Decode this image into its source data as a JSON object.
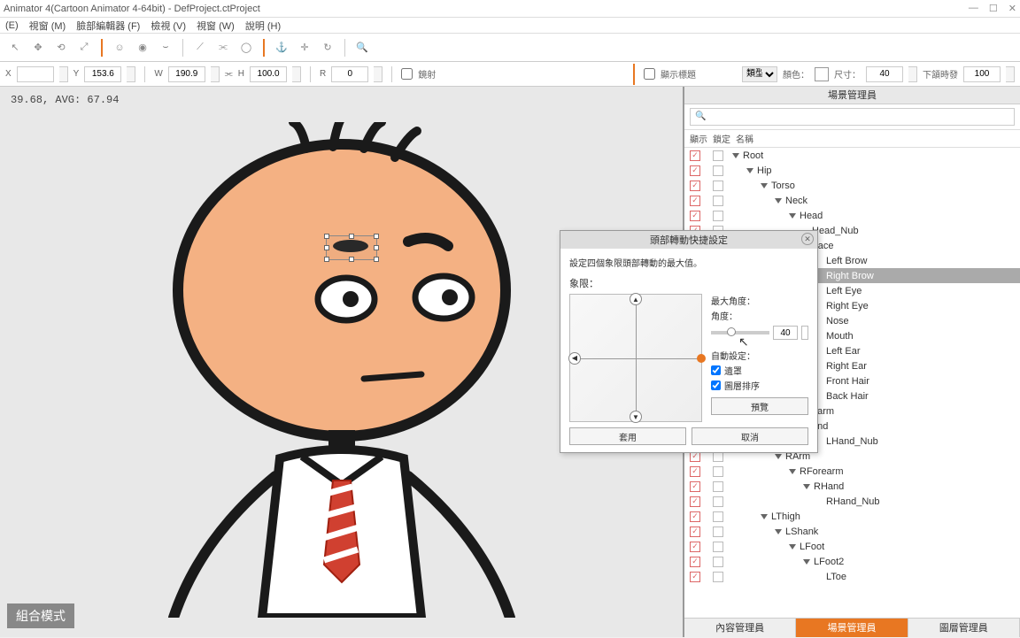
{
  "window": {
    "title": "Animator 4(Cartoon Animator 4-64bit) - DefProject.ctProject"
  },
  "menu": {
    "items": [
      "(E)",
      "視窗 (M)",
      "臉部編輯器 (F)",
      "檢視 (V)",
      "視窗 (W)",
      "說明 (H)"
    ]
  },
  "propbar": {
    "x": "",
    "y": "153.6",
    "w": "190.9",
    "h": "100.0",
    "r": "0",
    "mirror": "鏡射",
    "showTitle": "顯示標題",
    "type": "類型",
    "color": "顏色：",
    "size": "尺寸：",
    "sizeVal": "40",
    "pivot": "下頷時發",
    "pivotVal": "100"
  },
  "canvas": {
    "info": "39.68, AVG: 67.94",
    "modeBadge": "組合模式"
  },
  "panel": {
    "title": "場景管理員",
    "cols": {
      "show": "顯示",
      "lock": "鎖定",
      "name": "名稱"
    },
    "tree": [
      {
        "depth": 0,
        "exp": true,
        "label": "Root"
      },
      {
        "depth": 1,
        "exp": true,
        "label": "Hip"
      },
      {
        "depth": 2,
        "exp": true,
        "label": "Torso"
      },
      {
        "depth": 3,
        "exp": true,
        "label": "Neck"
      },
      {
        "depth": 4,
        "exp": true,
        "label": "Head"
      },
      {
        "depth": 5,
        "exp": false,
        "label": "Head_Nub"
      },
      {
        "depth": 5,
        "exp": false,
        "label": "Face"
      },
      {
        "depth": 6,
        "exp": false,
        "label": "Left Brow"
      },
      {
        "depth": 6,
        "exp": false,
        "label": "Right Brow",
        "selected": true
      },
      {
        "depth": 6,
        "exp": false,
        "label": "Left Eye"
      },
      {
        "depth": 6,
        "exp": false,
        "label": "Right Eye"
      },
      {
        "depth": 6,
        "exp": false,
        "label": "Nose"
      },
      {
        "depth": 6,
        "exp": false,
        "label": "Mouth"
      },
      {
        "depth": 6,
        "exp": false,
        "label": "Left Ear"
      },
      {
        "depth": 6,
        "exp": false,
        "label": "Right Ear"
      },
      {
        "depth": 6,
        "exp": false,
        "label": "Front Hair"
      },
      {
        "depth": 6,
        "exp": false,
        "label": "Back Hair"
      },
      {
        "depth": 5,
        "exp": false,
        "label": "earm"
      },
      {
        "depth": 4,
        "exp": true,
        "label": "LHand"
      },
      {
        "depth": 6,
        "exp": false,
        "label": "LHand_Nub"
      },
      {
        "depth": 3,
        "exp": true,
        "label": "RArm"
      },
      {
        "depth": 4,
        "exp": true,
        "label": "RForearm"
      },
      {
        "depth": 5,
        "exp": true,
        "label": "RHand"
      },
      {
        "depth": 6,
        "exp": false,
        "label": "RHand_Nub"
      },
      {
        "depth": 2,
        "exp": true,
        "label": "LThigh"
      },
      {
        "depth": 3,
        "exp": true,
        "label": "LShank"
      },
      {
        "depth": 4,
        "exp": true,
        "label": "LFoot"
      },
      {
        "depth": 5,
        "exp": true,
        "label": "LFoot2"
      },
      {
        "depth": 6,
        "exp": false,
        "label": "LToe"
      }
    ],
    "tabs": [
      "內容管理員",
      "場景管理員",
      "圖層管理員"
    ],
    "activeTab": 1
  },
  "dialog": {
    "title": "頭部轉動快捷設定",
    "desc": "設定四個象限頭部轉動的最大值。",
    "limitLabel": "象限：",
    "maxAngle": "最大角度：",
    "angle": "角度：",
    "angleVal": "40",
    "autoLabel": "自動設定：",
    "opt1": "遺罩",
    "opt2": "圖層排序",
    "preview": "預覽",
    "apply": "套用",
    "cancel": "取消"
  }
}
